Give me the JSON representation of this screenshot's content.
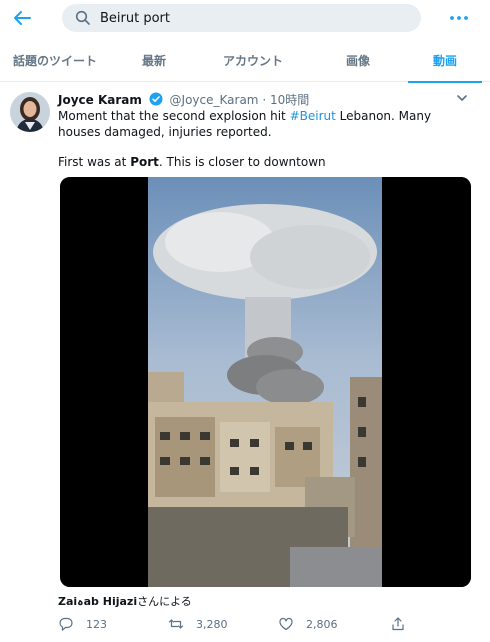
{
  "search": {
    "value": "Beirut port"
  },
  "tabs": [
    {
      "label": "話題のツイート",
      "active": false
    },
    {
      "label": "最新",
      "active": false
    },
    {
      "label": "アカウント",
      "active": false
    },
    {
      "label": "画像",
      "active": false
    },
    {
      "label": "動画",
      "active": true
    }
  ],
  "tweet": {
    "display_name": "Joyce Karam",
    "handle": "@Joyce_Karam",
    "separator": "·",
    "time": "10時間",
    "line1_pre": "Moment that the second explosion hit ",
    "hashtag": "#Beirut",
    "line1_post": " Lebanon. Many houses damaged, injuries reported.",
    "line2_pre": "First was at ",
    "line2_bold": "Port",
    "line2_post": ". This is closer to downtown",
    "attribution_name": "Zaiہab Hijazi",
    "attribution_suffix": "さんによる",
    "replies": "123",
    "retweets": "3,280",
    "likes": "2,806"
  },
  "colors": {
    "accent": "#1da1f2",
    "muted": "#5b7083",
    "divider": "#e6ecf0"
  },
  "icons": [
    "back-arrow-icon",
    "search-icon",
    "more-icon",
    "verified-icon",
    "caret-down-icon",
    "reply-icon",
    "retweet-icon",
    "like-icon",
    "share-icon"
  ]
}
